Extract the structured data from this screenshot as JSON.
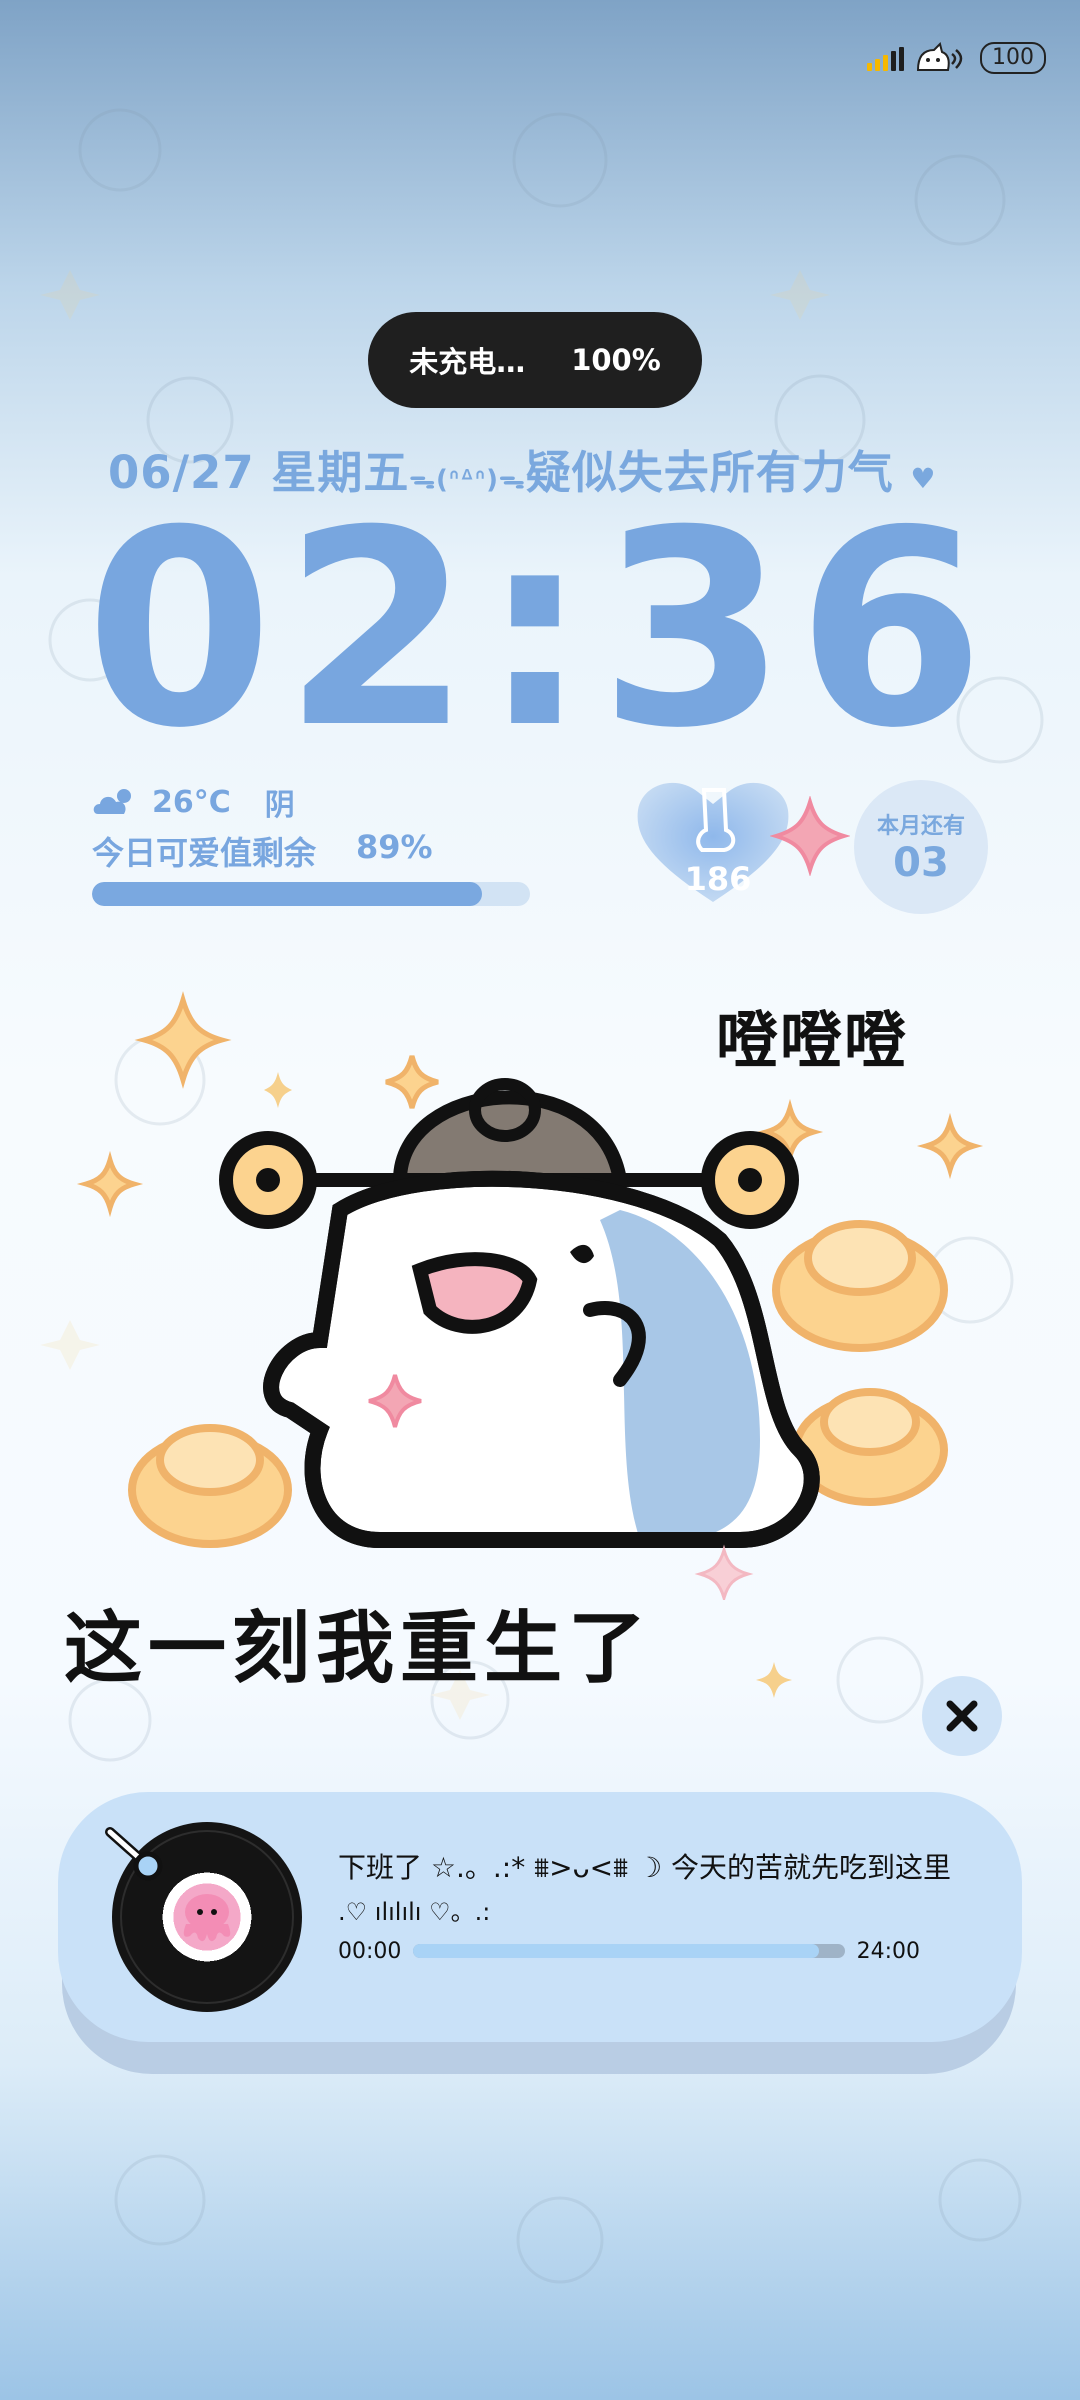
{
  "status": {
    "battery_value": "100",
    "signal_icon": "signal-bars-icon",
    "sound_icon": "cat-speaker-icon"
  },
  "charge": {
    "status": "未充电…",
    "percent": "100%"
  },
  "date": {
    "date": "06/27",
    "weekday": "星期五",
    "kaomoji": "ᯓ(ᐢᐞᐢ)ᯓ",
    "mood": "疑似失去所有力气"
  },
  "clock": {
    "time": "02:36"
  },
  "weather": {
    "icon": "cloud-sun-icon",
    "temp": "26°C",
    "condition": "阴"
  },
  "cute": {
    "label": "今日可爱值剩余",
    "percent_text": "89%",
    "value": 0.89
  },
  "widget": {
    "steps": "186",
    "month_label": "本月还有",
    "month_value": "03"
  },
  "art": {
    "caption_top": "噔噔噔",
    "caption_bottom": "这一刻我重生了"
  },
  "music": {
    "title": "下班了 ☆.。.:* ⩩>ᴗ<⩩ ☽ 今天的苦就先吃到这里",
    "subtitle": ".♡ ılılılı ♡。.:",
    "time_start": "00:00",
    "time_end": "24:00",
    "progress": 0.94
  },
  "colors": {
    "accent": "#7aa8de",
    "card": "#c9e1f8"
  }
}
